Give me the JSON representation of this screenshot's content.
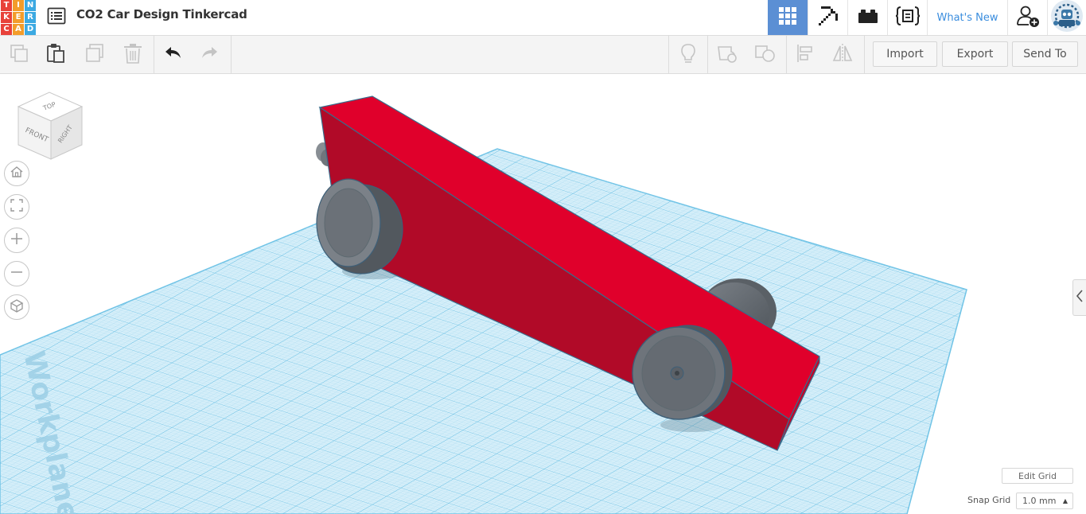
{
  "app": {
    "logo_letters": [
      "T",
      "I",
      "N",
      "K",
      "E",
      "R",
      "C",
      "A",
      "D"
    ],
    "logo_colors": [
      "#e8413a",
      "#f39c2a",
      "#3ca9e2",
      "#e8413a",
      "#f39c2a",
      "#3ca9e2",
      "#e8413a",
      "#f39c2a",
      "#3ca9e2"
    ],
    "document_title": "CO2 Car Design Tinkercad"
  },
  "topnav": {
    "items": [
      {
        "name": "3d-design",
        "icon": "grid-icon",
        "active": true
      },
      {
        "name": "minecraft",
        "icon": "pickaxe-icon",
        "active": false
      },
      {
        "name": "lego-bricks",
        "icon": "brick-icon",
        "active": false
      },
      {
        "name": "codeblocks",
        "icon": "codeblocks-icon",
        "active": false
      }
    ],
    "whats_new": "What's New",
    "user_icon": "add-user-icon",
    "avatar_icon": "robot-avatar-icon"
  },
  "toolbar": {
    "left_tools": [
      {
        "name": "copy",
        "icon": "copy-icon"
      },
      {
        "name": "paste",
        "icon": "paste-icon"
      },
      {
        "name": "duplicate",
        "icon": "duplicate-icon"
      },
      {
        "name": "delete",
        "icon": "trash-icon"
      },
      {
        "name": "undo",
        "icon": "undo-icon"
      },
      {
        "name": "redo",
        "icon": "redo-icon"
      }
    ],
    "right_tools": [
      {
        "name": "notes",
        "icon": "lightbulb-icon"
      },
      {
        "name": "group",
        "icon": "group-icon"
      },
      {
        "name": "ungroup",
        "icon": "ungroup-icon"
      },
      {
        "name": "align",
        "icon": "align-icon"
      },
      {
        "name": "mirror",
        "icon": "mirror-icon"
      }
    ],
    "import_label": "Import",
    "export_label": "Export",
    "send_to_label": "Send To"
  },
  "viewcube": {
    "top": "TOP",
    "front": "FRONT",
    "right": "RIGHT"
  },
  "navigation": {
    "home_icon": "home-icon",
    "fit_icon": "fit-view-icon",
    "zoom_in_icon": "plus-icon",
    "zoom_out_icon": "minus-icon",
    "perspective_icon": "cube-icon"
  },
  "workplane": {
    "label": "Workplane",
    "grid_color": "#6fc3e6",
    "fill_color": "#cdeaf6"
  },
  "model": {
    "body_color": "#e0002b",
    "body_side_color": "#b10a28",
    "wheel_color": "#6b7178"
  },
  "grid_controls": {
    "edit_grid_label": "Edit Grid",
    "snap_grid_label": "Snap Grid",
    "snap_value": "1.0 mm"
  },
  "colors": {
    "accent": "#5b8fd4",
    "link": "#3a8dde"
  }
}
